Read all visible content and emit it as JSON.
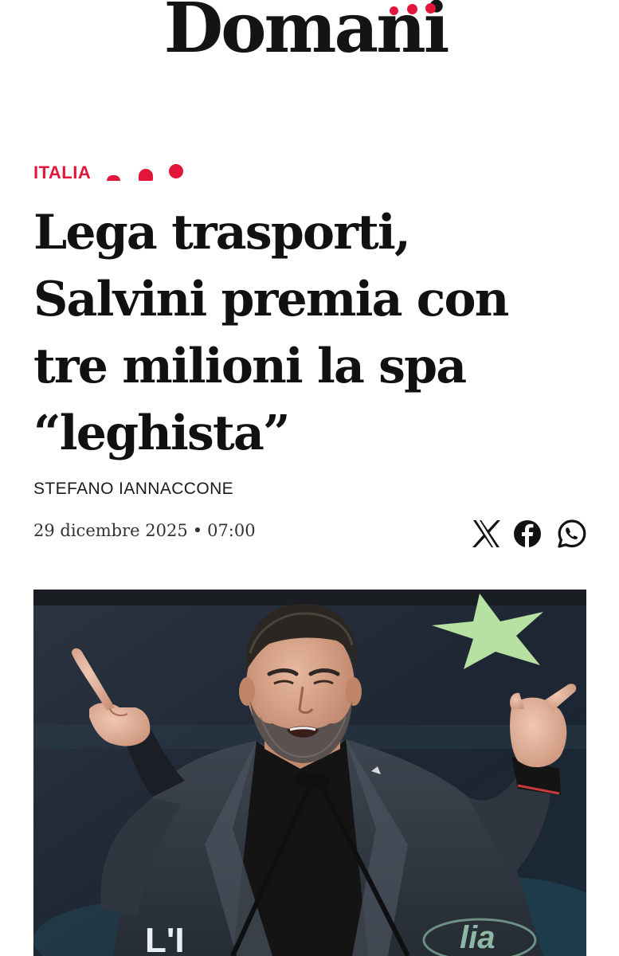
{
  "masthead": {
    "logo_text": "Domani",
    "accent_color": "#e2163b"
  },
  "article": {
    "category": "ITALIA",
    "headline_lines": [
      "Lega trasporti,",
      "Salvini premia con",
      "tre milioni la spa",
      "“leghista”"
    ],
    "author": "STEFANO IANNACCONE",
    "date": "29 dicembre 2025",
    "separator": "•",
    "time": "07:00"
  },
  "share": {
    "icons": [
      "x-icon",
      "facebook-icon",
      "whatsapp-icon"
    ]
  },
  "hero": {
    "podium_text_left": "L'I",
    "podium_text_right": "lia"
  }
}
